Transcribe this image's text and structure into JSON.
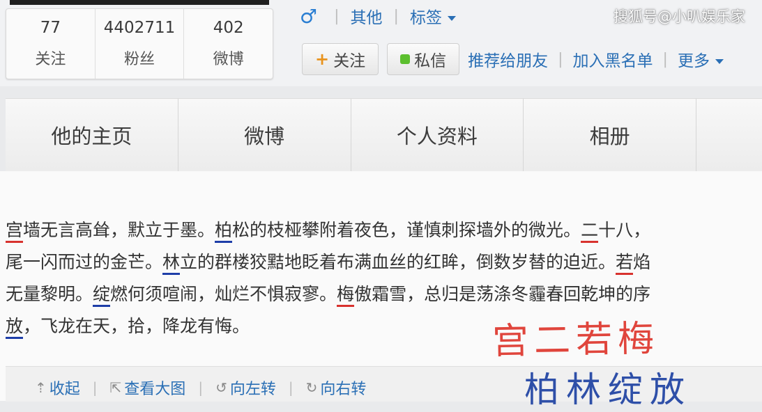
{
  "watermark": "搜狐号@小叭娱乐家",
  "profile": {
    "stats": [
      {
        "value": "77",
        "label": "关注"
      },
      {
        "value": "4402711",
        "label": "粉丝"
      },
      {
        "value": "402",
        "label": "微博"
      }
    ],
    "gender_icon": "male-icon",
    "gender_symbol": "♂",
    "other": "其他",
    "tags": "标签"
  },
  "actions": {
    "follow": "关注",
    "follow_plus": "+",
    "message": "私信",
    "recommend": "推荐给朋友",
    "blacklist": "加入黑名单",
    "more": "更多"
  },
  "nav": {
    "tabs": [
      "他的主页",
      "微博",
      "个人资料",
      "相册"
    ]
  },
  "post": {
    "lines": [
      [
        "宫",
        "墙无言高耸，默立于墨。",
        "柏",
        "松的枝桠攀附着夜色，谨慎刺探墙外的微光。",
        "二",
        "十八，"
      ],
      [
        "尾一闪而过的金芒。",
        "林",
        "立的群楼狡黠地眨着布满血丝的红眸，倒数岁替的迫近。",
        "若",
        "焰"
      ],
      [
        "无量黎明。",
        "绽",
        "燃何须喧闹，灿烂不惧寂寥。",
        "梅",
        "傲霜雪，总归是荡涤冬霾春回乾坤的序"
      ],
      [
        "放",
        "，飞龙在天，拾，降龙有悔。"
      ]
    ],
    "annotation_red": "宫二若梅",
    "annotation_blue": "柏林绽放"
  },
  "toolbar": {
    "collapse": "收起",
    "view_large": "查看大图",
    "rotate_left": "向左转",
    "rotate_right": "向右转"
  },
  "colors": {
    "link": "#2a6fb5",
    "underline_red": "#d8322e",
    "underline_blue": "#1e3ea8",
    "annotation_red": "#e0453c",
    "annotation_blue": "#2e4fa8"
  }
}
